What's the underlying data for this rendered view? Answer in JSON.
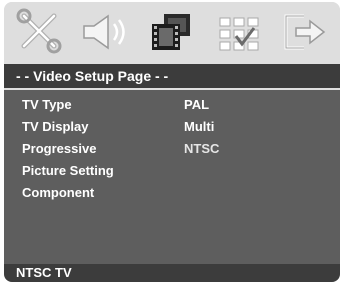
{
  "title": "- -  Video Setup Page  - -",
  "tabs": [
    {
      "name": "general-setup",
      "icon": "tools-icon"
    },
    {
      "name": "audio-setup",
      "icon": "speaker-icon"
    },
    {
      "name": "video-setup",
      "icon": "film-icon"
    },
    {
      "name": "preference-setup",
      "icon": "preference-grid-icon"
    },
    {
      "name": "exit",
      "icon": "exit-icon"
    }
  ],
  "menu": {
    "items": [
      {
        "label": "TV Type"
      },
      {
        "label": "TV Display"
      },
      {
        "label": "Progressive"
      },
      {
        "label": "Picture Setting"
      },
      {
        "label": "Component"
      }
    ],
    "options": [
      {
        "label": "PAL",
        "state": "normal"
      },
      {
        "label": "Multi",
        "state": "normal"
      },
      {
        "label": "NTSC",
        "state": "highlighted"
      }
    ]
  },
  "status": "NTSC TV",
  "colors": {
    "panel": "#5e5e5e",
    "bar": "#3c3c3c",
    "highlight_text": "#e6e6e6"
  }
}
